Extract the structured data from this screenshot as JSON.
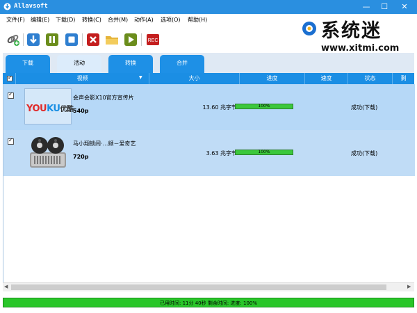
{
  "window": {
    "title": "Allavsoft",
    "min_label": "—",
    "max_label": "☐",
    "close_label": "✕"
  },
  "menu": [
    "文件(F)",
    "编辑(E)",
    "下载(D)",
    "转换(C)",
    "合并(M)",
    "动作(A)",
    "选项(O)",
    "帮助(H)"
  ],
  "toolbar": {
    "icons": [
      "add-link-icon",
      "download-icon",
      "pause-icon",
      "stop-icon",
      "delete-icon",
      "open-folder-icon",
      "play-icon",
      "record-icon"
    ],
    "rec_label": "REC"
  },
  "watermark": {
    "brand": "系统迷",
    "url": "www.xitmi.com"
  },
  "tabs": [
    {
      "label": "下载",
      "active": false
    },
    {
      "label": "活动",
      "active": true
    },
    {
      "label": "转换",
      "active": false
    },
    {
      "label": "合并",
      "active": false
    }
  ],
  "columns": {
    "video": "视频",
    "size": "大小",
    "progress": "进度",
    "speed": "速度",
    "status": "状态",
    "extra": "剩"
  },
  "rows": [
    {
      "checked": true,
      "thumb_logo": {
        "a": "YOU",
        "b": "KU",
        "c": "优酷"
      },
      "title": "会声会影X10官方宣传片",
      "resolution": "540p",
      "size": "13.60 兆字节",
      "progress_pct": 100,
      "progress_label": "100%",
      "status": "成功(下载)"
    },
    {
      "checked": true,
      "title": "马小翔锁间·…频－爱奇艺",
      "resolution": "720p",
      "size": "3.63 兆字节",
      "progress_pct": 100,
      "progress_label": "100%",
      "status": "成功(下载)"
    }
  ],
  "scroll": {
    "left": "◀",
    "right": "▶"
  },
  "statusbar": {
    "text": "已用时间: 11分 40秒  剩余时间:  进度: 100%"
  },
  "colors": {
    "titlebar": "#2a8fe0",
    "tab": "#1e90e6",
    "header": "#1b8ee4",
    "row_selected": "#b6d8f7",
    "progress": "#3cc83c"
  }
}
